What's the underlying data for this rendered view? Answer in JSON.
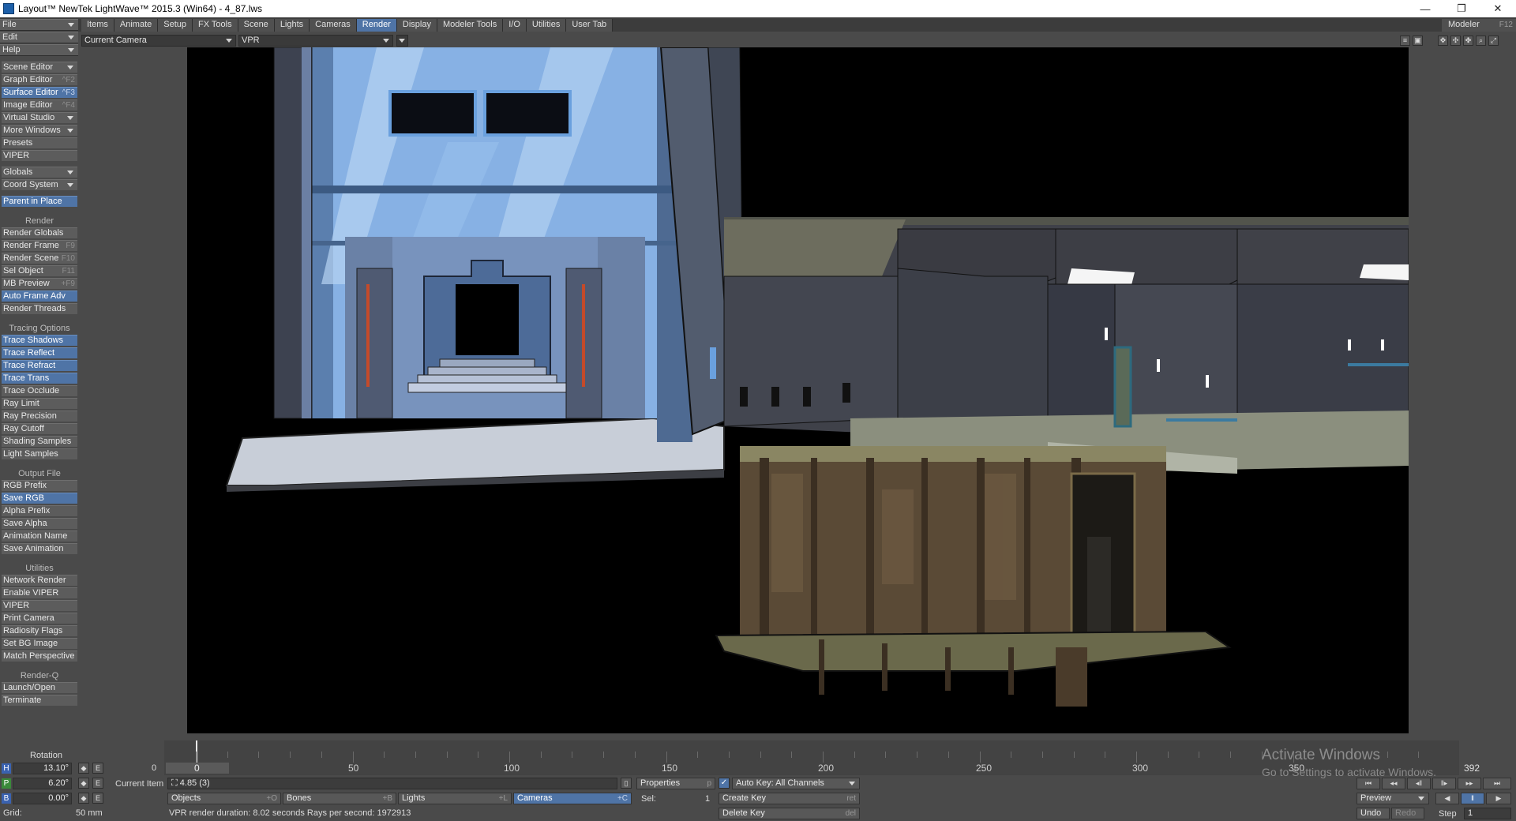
{
  "window": {
    "title": "Layout™ NewTek LightWave™ 2015.3 (Win64) - 4_87.lws",
    "controls": [
      "—",
      "❐",
      "✕"
    ]
  },
  "menus": [
    {
      "label": "File"
    },
    {
      "label": "Edit"
    },
    {
      "label": "Help"
    }
  ],
  "tabs": [
    {
      "label": "Items",
      "active": false
    },
    {
      "label": "Animate",
      "active": false
    },
    {
      "label": "Setup",
      "active": false
    },
    {
      "label": "FX Tools",
      "active": false
    },
    {
      "label": "Scene",
      "active": false
    },
    {
      "label": "Lights",
      "active": false
    },
    {
      "label": "Cameras",
      "active": false
    },
    {
      "label": "Render",
      "active": true
    },
    {
      "label": "Display",
      "active": false
    },
    {
      "label": "Modeler Tools",
      "active": false
    },
    {
      "label": "I/O",
      "active": false
    },
    {
      "label": "Utilities",
      "active": false
    },
    {
      "label": "User Tab",
      "active": false
    }
  ],
  "modeler": {
    "label": "Modeler",
    "shortcut": "F12"
  },
  "viewport_header": {
    "camera_select": "Current Camera",
    "mode_select": "VPR"
  },
  "sidebar": {
    "tools": [
      {
        "label": "Scene Editor",
        "shortcut": "",
        "dropdown": true,
        "active": false
      },
      {
        "label": "Graph Editor",
        "shortcut": "^F2",
        "dropdown": false,
        "active": false
      },
      {
        "label": "Surface Editor",
        "shortcut": "^F3",
        "dropdown": false,
        "active": true
      },
      {
        "label": "Image Editor",
        "shortcut": "^F4",
        "dropdown": false,
        "active": false
      },
      {
        "label": "Virtual Studio",
        "shortcut": "",
        "dropdown": true,
        "active": false
      },
      {
        "label": "More Windows",
        "shortcut": "",
        "dropdown": true,
        "active": false
      },
      {
        "label": "Presets",
        "shortcut": "",
        "dropdown": false,
        "active": false
      },
      {
        "label": "VIPER",
        "shortcut": "",
        "dropdown": false,
        "active": false
      }
    ],
    "globals": [
      {
        "label": "Globals",
        "dropdown": true
      },
      {
        "label": "Coord System",
        "dropdown": true
      }
    ],
    "parent_in_place": {
      "label": "Parent in Place",
      "active": true
    },
    "render_header": "Render",
    "render": [
      {
        "label": "Render Globals",
        "shortcut": "",
        "active": false
      },
      {
        "label": "Render Frame",
        "shortcut": "F9",
        "active": false
      },
      {
        "label": "Render Scene",
        "shortcut": "F10",
        "active": false
      },
      {
        "label": "Sel Object",
        "shortcut": "F11",
        "active": false
      },
      {
        "label": "MB Preview",
        "shortcut": "+F9",
        "active": false
      },
      {
        "label": "Auto Frame Adv",
        "shortcut": "",
        "active": true
      },
      {
        "label": "Render Threads",
        "shortcut": "",
        "active": false
      }
    ],
    "tracing_header": "Tracing Options",
    "tracing": [
      {
        "label": "Trace Shadows",
        "active": true
      },
      {
        "label": "Trace Reflect",
        "active": true
      },
      {
        "label": "Trace Refract",
        "active": true
      },
      {
        "label": "Trace Trans",
        "active": true
      },
      {
        "label": "Trace Occlude",
        "active": false
      },
      {
        "label": "Ray Limit",
        "active": false
      },
      {
        "label": "Ray Precision",
        "active": false
      },
      {
        "label": "Ray Cutoff",
        "active": false
      },
      {
        "label": "Shading Samples",
        "active": false
      },
      {
        "label": "Light Samples",
        "active": false
      }
    ],
    "output_header": "Output File",
    "output": [
      {
        "label": "RGB Prefix",
        "active": false
      },
      {
        "label": "Save RGB",
        "active": true
      },
      {
        "label": "Alpha Prefix",
        "active": false
      },
      {
        "label": "Save Alpha",
        "active": false
      },
      {
        "label": "Animation Name",
        "active": false
      },
      {
        "label": "Save Animation",
        "active": false
      }
    ],
    "utilities_header": "Utilities",
    "utilities": [
      {
        "label": "Network Render"
      },
      {
        "label": "Enable VIPER"
      },
      {
        "label": "VIPER"
      },
      {
        "label": "Print Camera"
      },
      {
        "label": "Radiosity Flags"
      },
      {
        "label": "Set BG Image"
      },
      {
        "label": "Match Perspective"
      }
    ],
    "renderq_header": "Render-Q",
    "renderq": [
      {
        "label": "Launch/Open"
      },
      {
        "label": "Terminate"
      }
    ]
  },
  "timeline": {
    "start_frame": "0",
    "current_frame": "0",
    "end_frame": "392",
    "ticks": [
      "50",
      "100",
      "150",
      "200",
      "250",
      "300",
      "350"
    ]
  },
  "watermark": {
    "title": "Activate Windows",
    "subtitle": "Go to Settings to activate Windows."
  },
  "rotation": {
    "label": "Rotation",
    "h": {
      "axis": "H",
      "value": "13.10°"
    },
    "p": {
      "axis": "P",
      "value": "6.20°"
    },
    "b": {
      "axis": "B",
      "value": "0.00°"
    }
  },
  "status": {
    "grid_label": "Grid:",
    "grid_value": "50 mm",
    "render_info": "VPR render duration: 8.02 seconds  Rays per second: 1972913"
  },
  "current_item": {
    "label": "Current Item",
    "value": "4.85 (3)"
  },
  "properties": {
    "label": "Properties",
    "shortcut": "p"
  },
  "item_types": [
    {
      "label": "Objects",
      "shortcut": "+O",
      "active": false
    },
    {
      "label": "Bones",
      "shortcut": "+B",
      "active": false
    },
    {
      "label": "Lights",
      "shortcut": "+L",
      "active": false
    },
    {
      "label": "Cameras",
      "shortcut": "+C",
      "active": true
    }
  ],
  "sel": {
    "label": "Sel:",
    "value": "1"
  },
  "auto_key": {
    "label": "Auto Key: All Channels",
    "checked": true
  },
  "create_key": {
    "label": "Create Key",
    "shortcut": "ret"
  },
  "delete_key": {
    "label": "Delete Key",
    "shortcut": "del"
  },
  "transport": {
    "preview_label": "Preview",
    "undo_label": "Undo",
    "redo_label": "Redo",
    "step_label": "Step",
    "step_value": "1",
    "buttons": [
      "⏮",
      "◂◂",
      "◂‖",
      "‖▸",
      "▸▸",
      "⏭"
    ],
    "play_buttons": [
      "◀",
      "‖",
      "▶"
    ]
  }
}
